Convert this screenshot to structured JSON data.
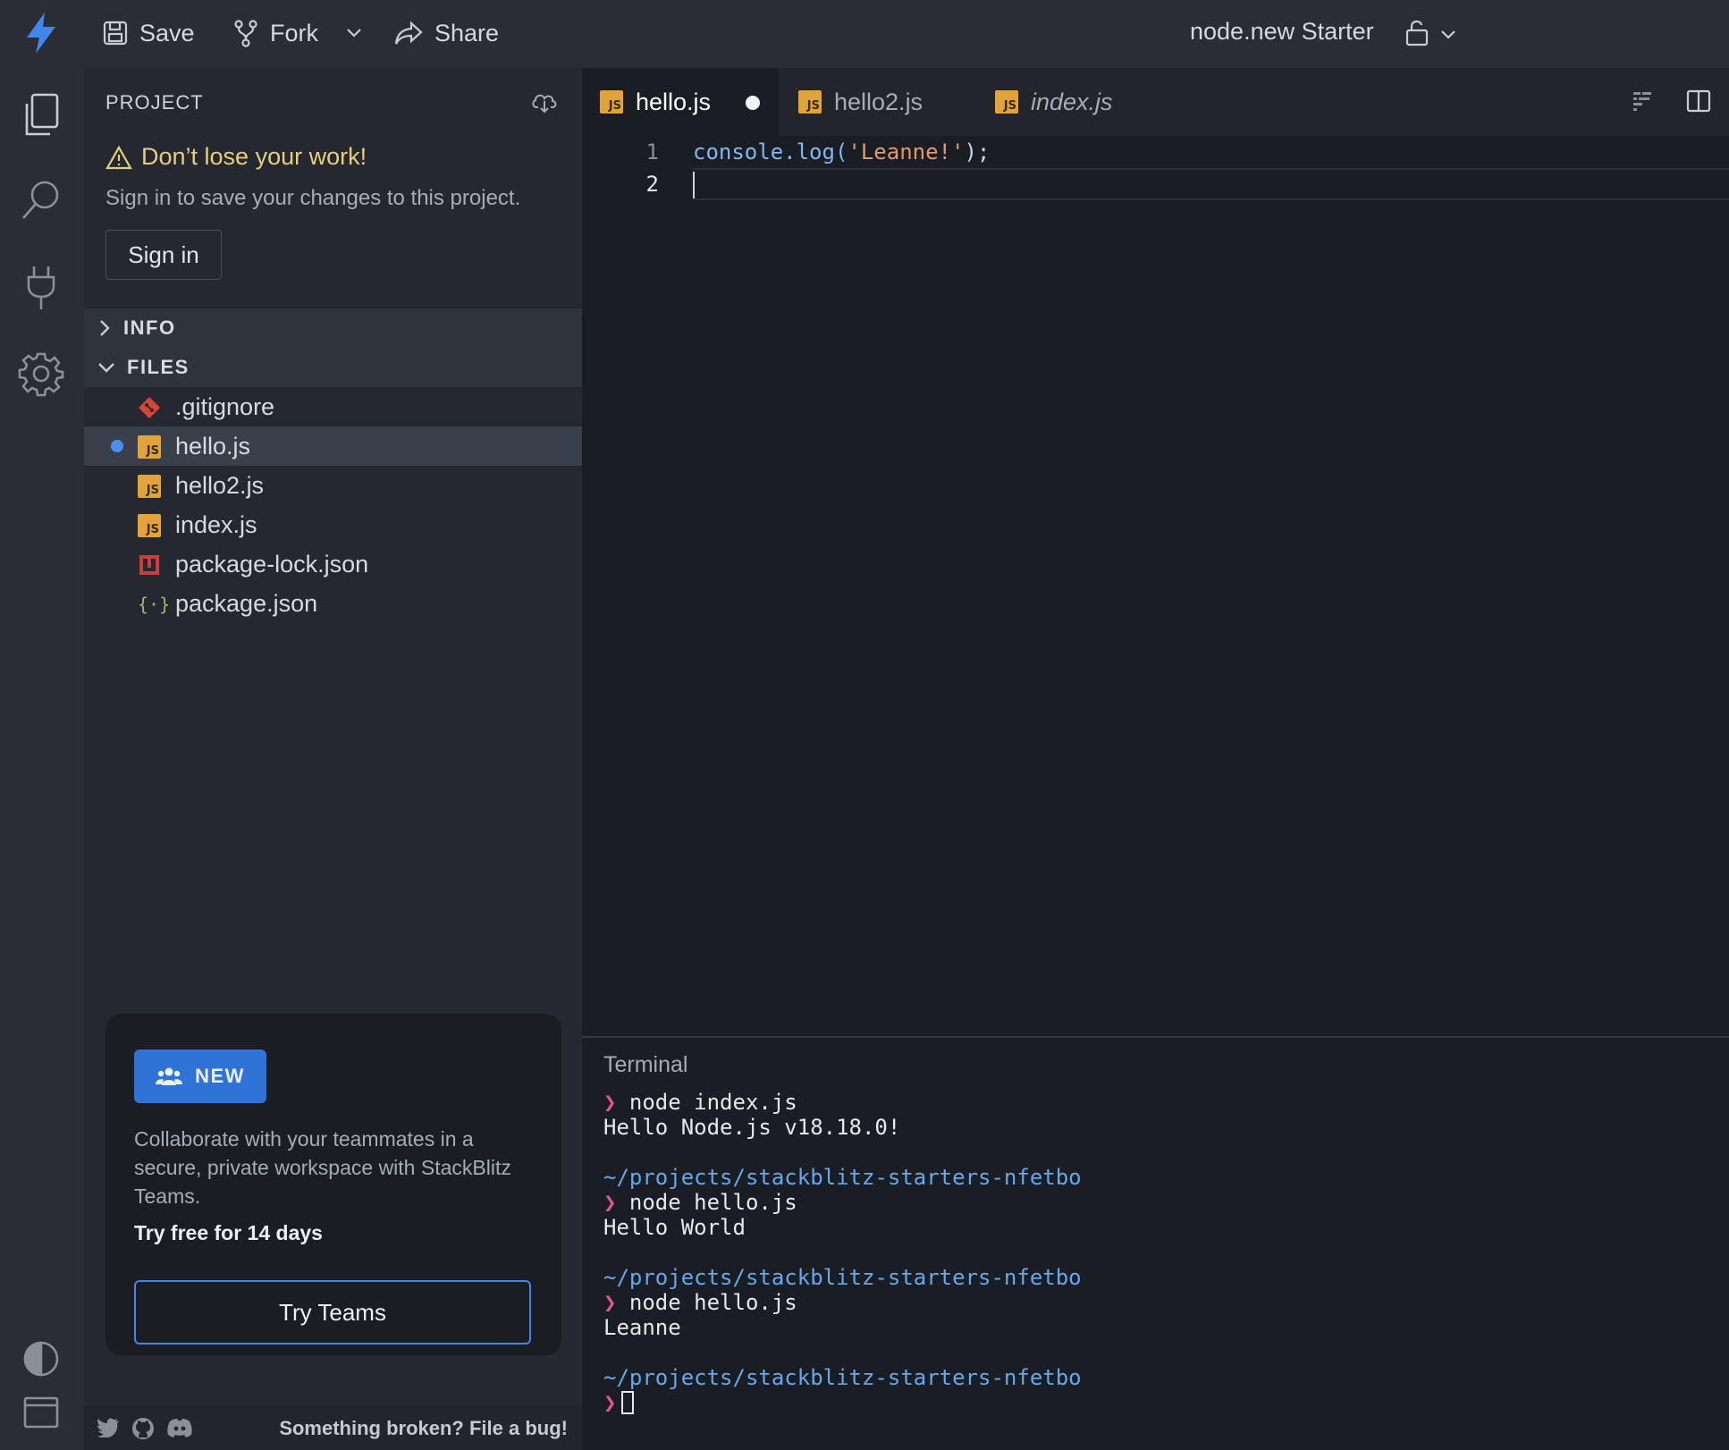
{
  "topbar": {
    "save_label": "Save",
    "fork_label": "Fork",
    "share_label": "Share",
    "project_title": "node.new Starter"
  },
  "sidebar": {
    "header": "PROJECT",
    "warning_title": "Don’t lose your work!",
    "warning_subtitle": "Sign in to save your changes to this project.",
    "signin_label": "Sign in",
    "sections": {
      "info": "INFO",
      "files": "FILES"
    },
    "files": [
      {
        "name": ".gitignore",
        "icon": "git-icon"
      },
      {
        "name": "hello.js",
        "icon": "js-icon",
        "modified": true,
        "active": true
      },
      {
        "name": "hello2.js",
        "icon": "js-icon"
      },
      {
        "name": "index.js",
        "icon": "js-icon"
      },
      {
        "name": "package-lock.json",
        "icon": "npm-icon"
      },
      {
        "name": "package.json",
        "icon": "json-icon"
      }
    ],
    "teams": {
      "badge": "NEW",
      "description": "Collaborate with your teammates in a secure, private workspace with StackBlitz Teams.",
      "free_trial": "Try free for 14 days",
      "button": "Try Teams"
    },
    "footer": {
      "bug_text": "Something broken? File a bug!"
    }
  },
  "editor": {
    "tabs": [
      {
        "label": "hello.js",
        "active": true,
        "modified": true
      },
      {
        "label": "hello2.js"
      },
      {
        "label": "index.js",
        "italic": true
      }
    ],
    "lines": [
      {
        "num": "1",
        "text": "console.log('Leanne!');"
      },
      {
        "num": "2",
        "text": ""
      }
    ],
    "code_tokens": {
      "fn": "console.log(",
      "str": "'Leanne!'",
      "end": ");"
    }
  },
  "terminal": {
    "title": "Terminal",
    "prompt_symbol": "❯",
    "lines": [
      {
        "type": "cmd",
        "text": "node index.js"
      },
      {
        "type": "out",
        "text": "Hello Node.js v18.18.0!"
      },
      {
        "type": "path",
        "text": "~/projects/stackblitz-starters-nfetbo"
      },
      {
        "type": "cmd",
        "text": "node hello.js"
      },
      {
        "type": "out",
        "text": "Hello World"
      },
      {
        "type": "path",
        "text": "~/projects/stackblitz-starters-nfetbo"
      },
      {
        "type": "cmd",
        "text": "node hello.js"
      },
      {
        "type": "out",
        "text": "Leanne"
      },
      {
        "type": "path",
        "text": "~/projects/stackblitz-starters-nfetbo"
      }
    ]
  },
  "colors": {
    "accent": "#2f73d6",
    "path": "#62a9ee",
    "prompt": "#e0559a",
    "js": "#e2a33b",
    "warning": "#e6cf7a"
  }
}
